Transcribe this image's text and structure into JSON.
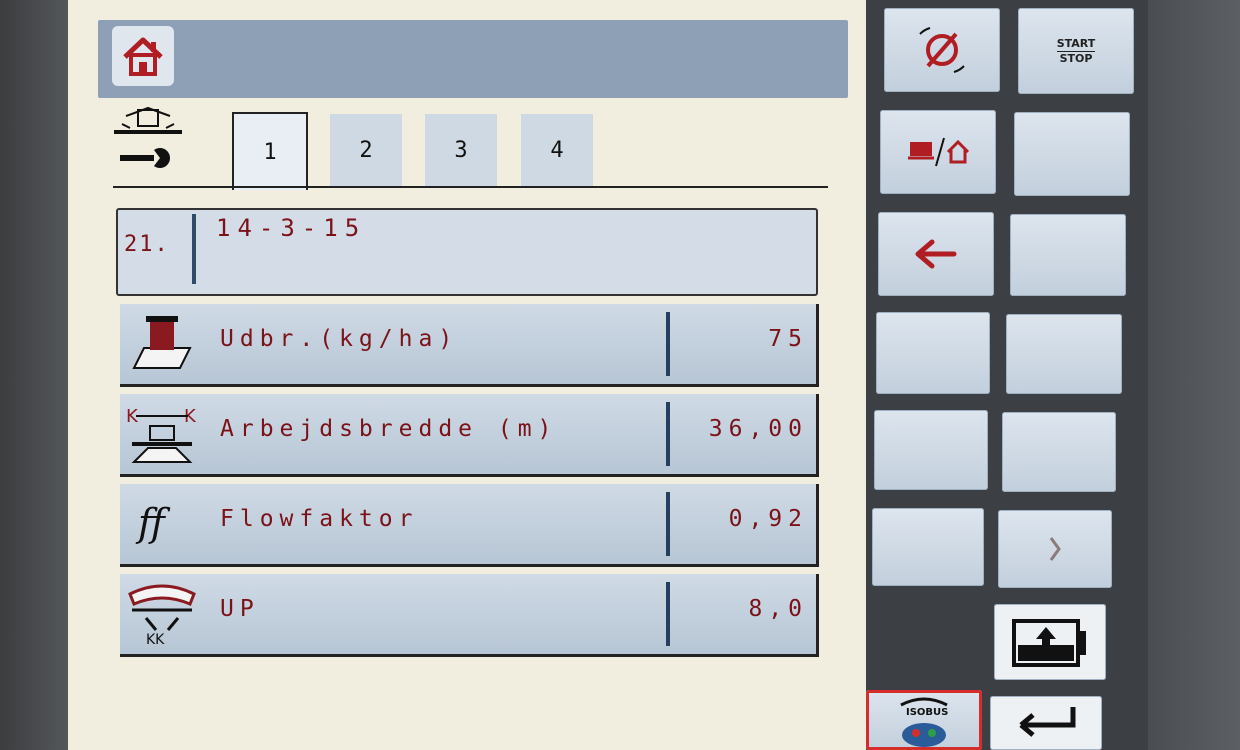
{
  "tabs": [
    {
      "label": "1",
      "active": true
    },
    {
      "label": "2",
      "active": false
    },
    {
      "label": "3",
      "active": false
    },
    {
      "label": "4",
      "active": false
    }
  ],
  "product": {
    "number": "21.",
    "name": "14-3-15"
  },
  "parameters": [
    {
      "icon": "weight-scale-icon",
      "label": "Udbr.(kg/ha)",
      "value": "75"
    },
    {
      "icon": "working-width-icon",
      "label": "Arbejdsbredde (m)",
      "value": "36,00"
    },
    {
      "icon": "flow-factor-icon",
      "label": "Flowfaktor",
      "value": "0,92"
    },
    {
      "icon": "spread-disc-icon",
      "label": "UP",
      "value": "8,0"
    }
  ],
  "softkeys": {
    "start_top": "START",
    "start_bottom": "STOP",
    "isobus_label": "ISOBUS"
  },
  "colors": {
    "accent_text": "#7b1218",
    "header_bar": "#8da0b5",
    "isobus_highlight": "#d62c2c"
  }
}
